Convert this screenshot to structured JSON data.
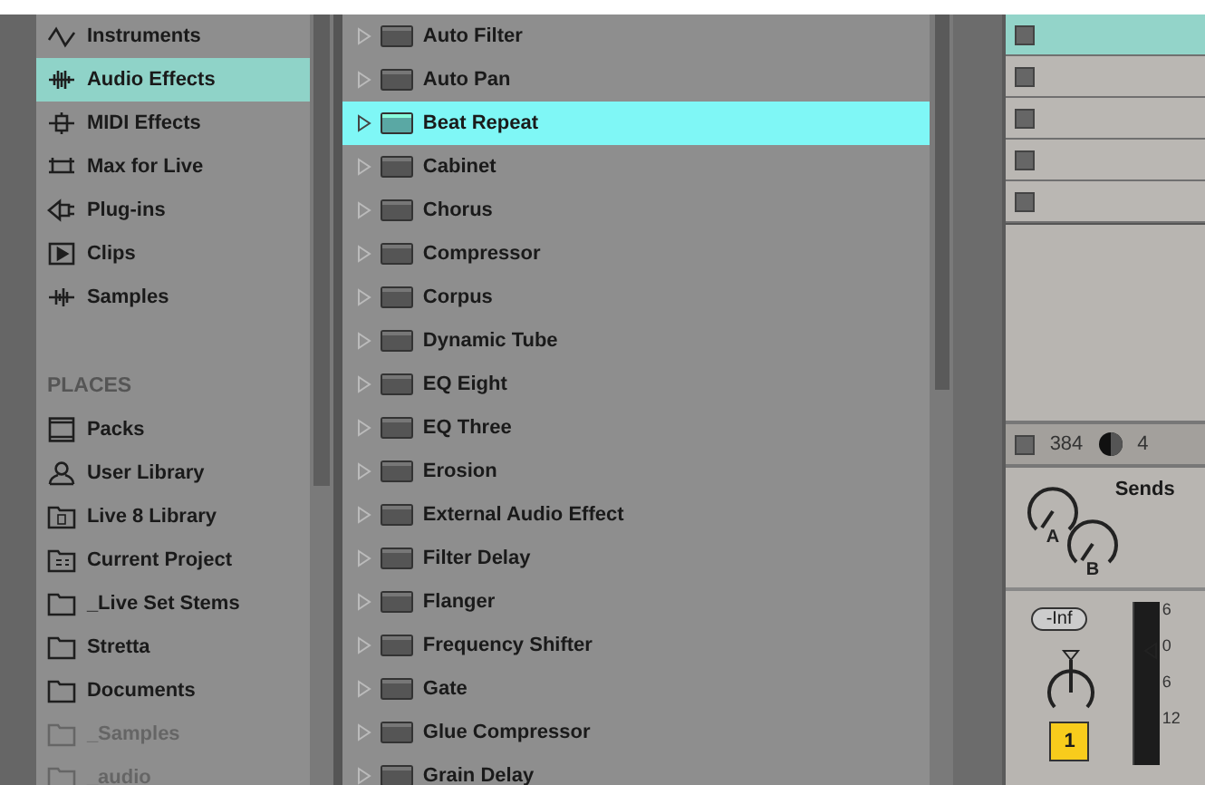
{
  "categories": [
    {
      "label": "Instruments",
      "kind": "wave",
      "selected": false
    },
    {
      "label": "Audio Effects",
      "kind": "audio",
      "selected": true
    },
    {
      "label": "MIDI Effects",
      "kind": "midi",
      "selected": false
    },
    {
      "label": "Max for Live",
      "kind": "max",
      "selected": false
    },
    {
      "label": "Plug-ins",
      "kind": "plug",
      "selected": false
    },
    {
      "label": "Clips",
      "kind": "clip",
      "selected": false
    },
    {
      "label": "Samples",
      "kind": "sample",
      "selected": false
    }
  ],
  "places_heading": "PLACES",
  "places": [
    {
      "label": "Packs",
      "kind": "pack",
      "dimmed": false
    },
    {
      "label": "User Library",
      "kind": "user",
      "dimmed": false
    },
    {
      "label": "Live 8 Library",
      "kind": "library",
      "dimmed": false
    },
    {
      "label": "Current Project",
      "kind": "project",
      "dimmed": false
    },
    {
      "label": "_Live Set Stems",
      "kind": "folder",
      "dimmed": false
    },
    {
      "label": "Stretta",
      "kind": "folder",
      "dimmed": false
    },
    {
      "label": "Documents",
      "kind": "folder",
      "dimmed": false
    },
    {
      "label": "_Samples",
      "kind": "folder",
      "dimmed": true
    },
    {
      "label": "_audio",
      "kind": "folder",
      "dimmed": true
    }
  ],
  "devices": [
    {
      "label": "Auto Filter",
      "selected": false
    },
    {
      "label": "Auto Pan",
      "selected": false
    },
    {
      "label": "Beat Repeat",
      "selected": true
    },
    {
      "label": "Cabinet",
      "selected": false
    },
    {
      "label": "Chorus",
      "selected": false
    },
    {
      "label": "Compressor",
      "selected": false
    },
    {
      "label": "Corpus",
      "selected": false
    },
    {
      "label": "Dynamic Tube",
      "selected": false
    },
    {
      "label": "EQ Eight",
      "selected": false
    },
    {
      "label": "EQ Three",
      "selected": false
    },
    {
      "label": "Erosion",
      "selected": false
    },
    {
      "label": "External Audio Effect",
      "selected": false
    },
    {
      "label": "Filter Delay",
      "selected": false
    },
    {
      "label": "Flanger",
      "selected": false
    },
    {
      "label": "Frequency Shifter",
      "selected": false
    },
    {
      "label": "Gate",
      "selected": false
    },
    {
      "label": "Glue Compressor",
      "selected": false
    },
    {
      "label": "Grain Delay",
      "selected": false
    }
  ],
  "clip_slots": [
    {
      "selected": true
    },
    {
      "selected": false
    },
    {
      "selected": false
    },
    {
      "selected": false
    },
    {
      "selected": false
    }
  ],
  "track_bar": {
    "value": "384",
    "count": "4"
  },
  "sends": {
    "label": "Sends",
    "knobs": [
      "A",
      "B"
    ]
  },
  "mixer": {
    "volume": "-Inf",
    "track_number": "1",
    "scale": [
      "6",
      "0",
      "6",
      "12"
    ]
  }
}
